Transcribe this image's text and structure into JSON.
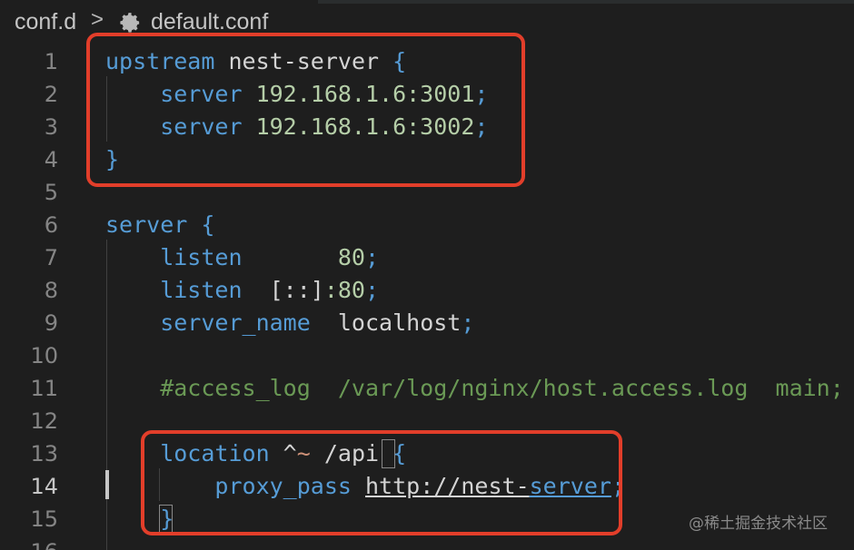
{
  "breadcrumb": {
    "folder": "conf.d",
    "separator": ">",
    "file": "default.conf",
    "file_icon": "gear-icon"
  },
  "lines": [
    {
      "n": "1",
      "tokens": [
        {
          "t": "upstream",
          "c": "kw"
        },
        {
          "t": " nest",
          "c": "plain"
        },
        {
          "t": "-",
          "c": "plain"
        },
        {
          "t": "server",
          "c": "plain"
        },
        {
          "t": " {",
          "c": "kw"
        }
      ]
    },
    {
      "n": "2",
      "tokens": [
        {
          "t": "    server",
          "c": "kw"
        },
        {
          "t": " 192.168.1.6:3001",
          "c": "num"
        },
        {
          "t": ";",
          "c": "kw"
        }
      ]
    },
    {
      "n": "3",
      "tokens": [
        {
          "t": "    server",
          "c": "kw"
        },
        {
          "t": " 192.168.1.6:3002",
          "c": "num"
        },
        {
          "t": ";",
          "c": "kw"
        }
      ]
    },
    {
      "n": "4",
      "tokens": [
        {
          "t": "}",
          "c": "kw"
        }
      ]
    },
    {
      "n": "5",
      "tokens": []
    },
    {
      "n": "6",
      "tokens": [
        {
          "t": "server",
          "c": "kw"
        },
        {
          "t": " {",
          "c": "kw"
        }
      ]
    },
    {
      "n": "7",
      "tokens": [
        {
          "t": "    listen",
          "c": "kw"
        },
        {
          "t": "       80",
          "c": "num"
        },
        {
          "t": ";",
          "c": "kw"
        }
      ]
    },
    {
      "n": "8",
      "tokens": [
        {
          "t": "    listen",
          "c": "kw"
        },
        {
          "t": "  [::]",
          "c": "plain"
        },
        {
          "t": ":80",
          "c": "num"
        },
        {
          "t": ";",
          "c": "kw"
        }
      ]
    },
    {
      "n": "9",
      "tokens": [
        {
          "t": "    server_name",
          "c": "kw"
        },
        {
          "t": "  localhost",
          "c": "plain"
        },
        {
          "t": ";",
          "c": "kw"
        }
      ]
    },
    {
      "n": "10",
      "tokens": []
    },
    {
      "n": "11",
      "tokens": [
        {
          "t": "    #access_log  /var/log/nginx/host.access.log  main;",
          "c": "cmt"
        }
      ]
    },
    {
      "n": "12",
      "tokens": []
    },
    {
      "n": "13",
      "tokens": [
        {
          "t": "    location",
          "c": "kw"
        },
        {
          "t": " ^",
          "c": "plain"
        },
        {
          "t": "~",
          "c": "op"
        },
        {
          "t": " /api",
          "c": "plain"
        },
        {
          "t": " {",
          "c": "kw"
        }
      ]
    },
    {
      "n": "14",
      "tokens": [
        {
          "t": "        proxy_pass",
          "c": "kw"
        },
        {
          "t": " ",
          "c": "plain"
        },
        {
          "t": "http://nest-",
          "c": "url"
        },
        {
          "t": "server",
          "c": "url-kw"
        },
        {
          "t": ";",
          "c": "kw"
        }
      ],
      "active": true
    },
    {
      "n": "15",
      "tokens": [
        {
          "t": "    }",
          "c": "kw"
        }
      ]
    },
    {
      "n": "16",
      "tokens": []
    }
  ],
  "watermark": "@稀土掘金技术社区",
  "colors": {
    "background": "#1e1e1e",
    "keyword": "#569cd6",
    "number": "#b5cea8",
    "comment": "#6a9955",
    "highlight": "#e23e2a"
  }
}
